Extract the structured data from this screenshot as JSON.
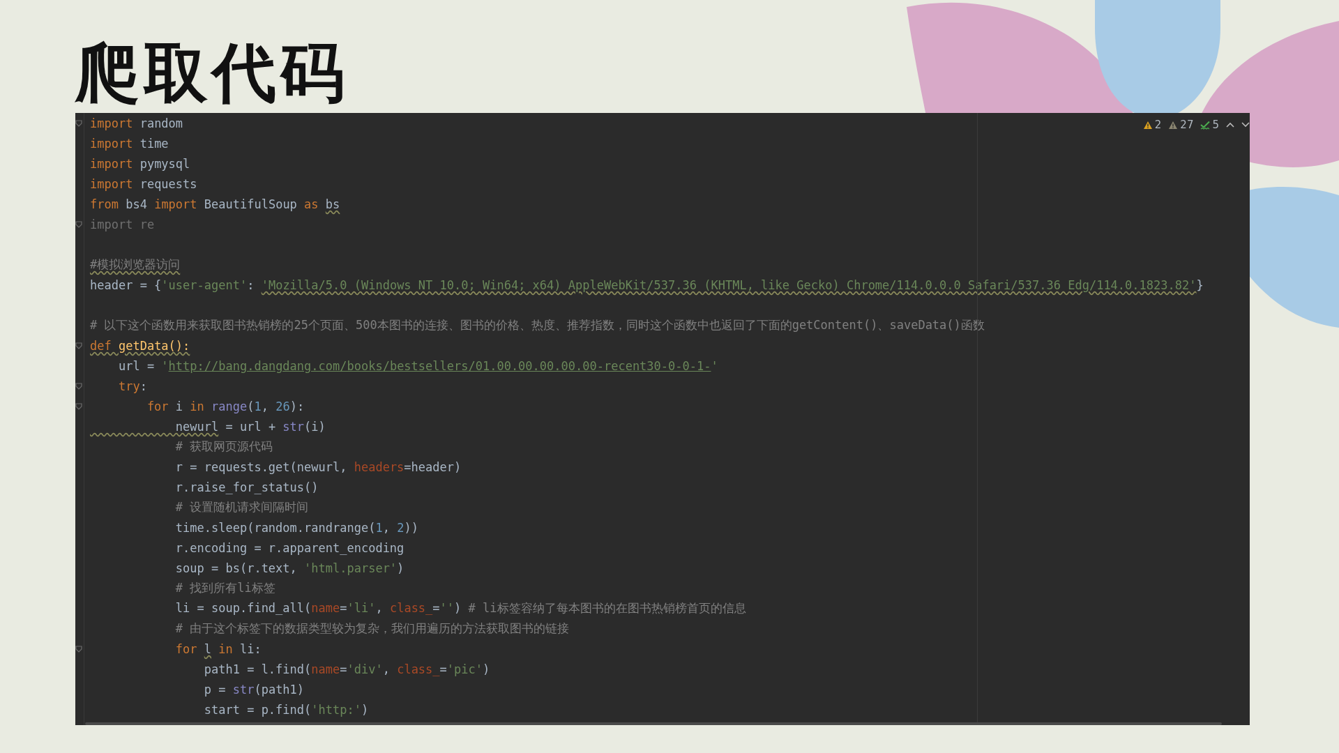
{
  "title": "爬取代码",
  "inspections": [
    {
      "kind": "warning",
      "count": "2"
    },
    {
      "kind": "weak",
      "count": "27"
    },
    {
      "kind": "ok",
      "count": "5"
    }
  ],
  "lines": [
    {
      "kind": "code",
      "fold": true,
      "tokens": [
        {
          "kind": "kw",
          "text": "import"
        },
        {
          "kind": "plain",
          "text": " random"
        }
      ]
    },
    {
      "kind": "code",
      "fold": false,
      "tokens": [
        {
          "kind": "kw",
          "text": "import"
        },
        {
          "kind": "plain",
          "text": " time"
        }
      ]
    },
    {
      "kind": "code",
      "fold": false,
      "tokens": [
        {
          "kind": "kw",
          "text": "import"
        },
        {
          "kind": "plain",
          "text": " pymysql"
        }
      ]
    },
    {
      "kind": "code",
      "fold": false,
      "tokens": [
        {
          "kind": "kw",
          "text": "import"
        },
        {
          "kind": "plain",
          "text": " requests"
        }
      ]
    },
    {
      "kind": "code",
      "fold": false,
      "tokens": [
        {
          "kind": "kw",
          "text": "from"
        },
        {
          "kind": "plain",
          "text": " bs4 "
        },
        {
          "kind": "kw",
          "text": "import"
        },
        {
          "kind": "plain",
          "text": " BeautifulSoup "
        },
        {
          "kind": "kw",
          "text": "as "
        },
        {
          "kind": "plain",
          "text": "bs",
          "squiggle": true
        }
      ]
    },
    {
      "kind": "code",
      "fold": true,
      "tokens": [
        {
          "kind": "dim",
          "text": "import re"
        }
      ]
    },
    {
      "kind": "blank",
      "fold": false
    },
    {
      "kind": "code",
      "fold": false,
      "tokens": [
        {
          "kind": "comment",
          "text": "#模拟浏览器访问",
          "squiggle": true
        }
      ]
    },
    {
      "kind": "code",
      "fold": false,
      "tokens": [
        {
          "kind": "plain",
          "text": "header = {"
        },
        {
          "kind": "str",
          "text": "'user-agent'"
        },
        {
          "kind": "plain",
          "text": ": "
        },
        {
          "kind": "str",
          "text": "'Mozilla/5.0 (Windows NT 10.0; Win64; x64) AppleWebKit/537.36 (KHTML, like Gecko) Chrome/114.0.0.0 Safari/537.36 Edg/114.0.1823.82'",
          "squiggle": true
        },
        {
          "kind": "plain",
          "text": "}"
        }
      ]
    },
    {
      "kind": "blank",
      "fold": false
    },
    {
      "kind": "code",
      "fold": false,
      "tokens": [
        {
          "kind": "comment",
          "text": "# 以下这个函数用来获取图书热销榜的25个页面、500本图书的连接、图书的价格、热度、推荐指数，同时这个函数中也返回了下面的getContent()、saveData()函数"
        }
      ]
    },
    {
      "kind": "code",
      "fold": true,
      "tokens": [
        {
          "kind": "kw",
          "text": "def ",
          "squiggle": true
        },
        {
          "kind": "fn",
          "text": "getData():",
          "squiggle": true
        }
      ]
    },
    {
      "kind": "code",
      "fold": false,
      "tokens": [
        {
          "kind": "plain",
          "text": "    url = "
        },
        {
          "kind": "str",
          "text": "'"
        },
        {
          "kind": "url",
          "text": "http://bang.dangdang.com/books/bestsellers/01.00.00.00.00.00-recent30-0-0-1-"
        },
        {
          "kind": "str",
          "text": "'"
        }
      ]
    },
    {
      "kind": "code",
      "fold": true,
      "tokens": [
        {
          "kind": "kw",
          "text": "    try"
        },
        {
          "kind": "plain",
          "text": ":"
        }
      ]
    },
    {
      "kind": "code",
      "fold": true,
      "tokens": [
        {
          "kind": "kw",
          "text": "        for"
        },
        {
          "kind": "plain",
          "text": " i "
        },
        {
          "kind": "kw",
          "text": "in"
        },
        {
          "kind": "builtin",
          "text": " range"
        },
        {
          "kind": "plain",
          "text": "("
        },
        {
          "kind": "num",
          "text": "1"
        },
        {
          "kind": "plain",
          "text": ", "
        },
        {
          "kind": "num",
          "text": "26"
        },
        {
          "kind": "plain",
          "text": "):"
        }
      ]
    },
    {
      "kind": "code",
      "fold": false,
      "tokens": [
        {
          "kind": "plain",
          "text": "            newurl",
          "squiggle": true
        },
        {
          "kind": "plain",
          "text": " = url + "
        },
        {
          "kind": "builtin",
          "text": "str"
        },
        {
          "kind": "plain",
          "text": "(i)"
        }
      ]
    },
    {
      "kind": "code",
      "fold": false,
      "tokens": [
        {
          "kind": "comment",
          "text": "            # 获取网页源代码"
        }
      ]
    },
    {
      "kind": "code",
      "fold": false,
      "tokens": [
        {
          "kind": "plain",
          "text": "            r = requests.get(newurl, "
        },
        {
          "kind": "param",
          "text": "headers"
        },
        {
          "kind": "plain",
          "text": "=header)"
        }
      ]
    },
    {
      "kind": "code",
      "fold": false,
      "tokens": [
        {
          "kind": "plain",
          "text": "            r.raise_for_status()"
        }
      ]
    },
    {
      "kind": "code",
      "fold": false,
      "tokens": [
        {
          "kind": "comment",
          "text": "            # 设置随机请求间隔时间"
        }
      ]
    },
    {
      "kind": "code",
      "fold": false,
      "tokens": [
        {
          "kind": "plain",
          "text": "            time.sleep(random.randrange("
        },
        {
          "kind": "num",
          "text": "1"
        },
        {
          "kind": "plain",
          "text": ", "
        },
        {
          "kind": "num",
          "text": "2"
        },
        {
          "kind": "plain",
          "text": "))"
        }
      ]
    },
    {
      "kind": "code",
      "fold": false,
      "tokens": [
        {
          "kind": "plain",
          "text": "            r.encoding = r.apparent_encoding"
        }
      ]
    },
    {
      "kind": "code",
      "fold": false,
      "tokens": [
        {
          "kind": "plain",
          "text": "            soup = bs(r.text, "
        },
        {
          "kind": "str",
          "text": "'html.parser'"
        },
        {
          "kind": "plain",
          "text": ")"
        }
      ]
    },
    {
      "kind": "code",
      "fold": false,
      "tokens": [
        {
          "kind": "comment",
          "text": "            # 找到所有li标签"
        }
      ]
    },
    {
      "kind": "code",
      "fold": false,
      "tokens": [
        {
          "kind": "plain",
          "text": "            li = soup.find_all("
        },
        {
          "kind": "param",
          "text": "name"
        },
        {
          "kind": "plain",
          "text": "="
        },
        {
          "kind": "str",
          "text": "'li'"
        },
        {
          "kind": "plain",
          "text": ", "
        },
        {
          "kind": "param",
          "text": "class_"
        },
        {
          "kind": "plain",
          "text": "="
        },
        {
          "kind": "str",
          "text": "''"
        },
        {
          "kind": "plain",
          "text": ") "
        },
        {
          "kind": "comment",
          "text": "# li标签容纳了每本图书的在图书热销榜首页的信息"
        }
      ]
    },
    {
      "kind": "code",
      "fold": false,
      "tokens": [
        {
          "kind": "comment",
          "text": "            # 由于这个标签下的数据类型较为复杂，我们用遍历的方法获取图书的链接"
        }
      ]
    },
    {
      "kind": "code",
      "fold": true,
      "tokens": [
        {
          "kind": "kw",
          "text": "            for "
        },
        {
          "kind": "plain",
          "text": "l",
          "squiggle": true
        },
        {
          "kind": "kw",
          "text": " in"
        },
        {
          "kind": "plain",
          "text": " li:"
        }
      ]
    },
    {
      "kind": "code",
      "fold": false,
      "tokens": [
        {
          "kind": "plain",
          "text": "                path1 = l.find("
        },
        {
          "kind": "param",
          "text": "name"
        },
        {
          "kind": "plain",
          "text": "="
        },
        {
          "kind": "str",
          "text": "'div'"
        },
        {
          "kind": "plain",
          "text": ", "
        },
        {
          "kind": "param",
          "text": "class_"
        },
        {
          "kind": "plain",
          "text": "="
        },
        {
          "kind": "str",
          "text": "'pic'"
        },
        {
          "kind": "plain",
          "text": ")"
        }
      ]
    },
    {
      "kind": "code",
      "fold": false,
      "tokens": [
        {
          "kind": "plain",
          "text": "                p = "
        },
        {
          "kind": "builtin",
          "text": "str"
        },
        {
          "kind": "plain",
          "text": "(path1)"
        }
      ]
    },
    {
      "kind": "code",
      "fold": false,
      "tokens": [
        {
          "kind": "plain",
          "text": "                start = p.find("
        },
        {
          "kind": "str",
          "text": "'http:'"
        },
        {
          "kind": "plain",
          "text": ")"
        }
      ]
    }
  ]
}
